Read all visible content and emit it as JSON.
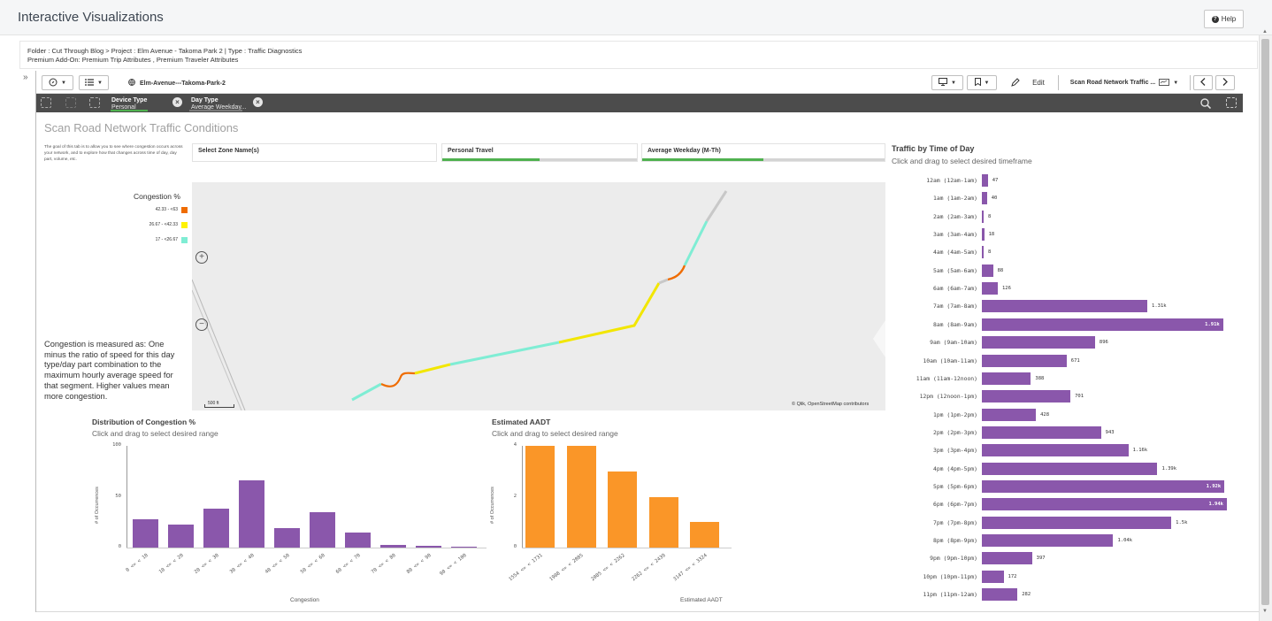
{
  "app": {
    "title": "Interactive Visualizations",
    "help_label": "Help"
  },
  "breadcrumb": {
    "line1": "Folder : Cut Through Blog  >  Project : Elm Avenue - Takoma Park 2  |  Type : Traffic Diagnostics",
    "line2": "Premium Add-On:  Premium Trip Attributes ,  Premium Traveler Attributes"
  },
  "toolbar": {
    "app_name": "Elm-Avenue---Takoma-Park-2",
    "edit_label": "Edit",
    "sheet_name": "Scan Road Network Traffic ...",
    "icons": [
      "compass-icon",
      "list-icon",
      "globe-icon",
      "present-icon",
      "bookmark-icon",
      "pencil-icon",
      "chevron-left-icon",
      "chevron-right-icon"
    ]
  },
  "selections": {
    "chips": [
      {
        "field": "Device Type",
        "value": "Personal"
      },
      {
        "field": "Day Type",
        "value": "Average Weekday..."
      }
    ]
  },
  "sheet": {
    "title": "Scan Road Network Traffic Conditions",
    "intro": "The goal of this tab is to allow you to see where congestion occurs across your network, and to explore how that changes across time of day, day part, volume, etc.",
    "filters": [
      {
        "label": "Select Zone Name(s)",
        "selected_fraction": 0.0
      },
      {
        "label": "Personal Travel",
        "selected_fraction": 0.5
      },
      {
        "label": "Average Weekday (M-Th)",
        "selected_fraction": 0.5
      }
    ],
    "congestion_note": "Congestion is measured as: One minus the ratio of speed for this day type/day part combination to the maximum hourly average speed for that segment. Higher values mean more congestion."
  },
  "legend": {
    "title": "Congestion %",
    "items": [
      {
        "label": "42.33 - <63",
        "color": "#ef6c00"
      },
      {
        "label": "26.67 - <42.33",
        "color": "#fff200"
      },
      {
        "label": "17 - <26.67",
        "color": "#7fedd4"
      }
    ]
  },
  "map": {
    "scale_label": "500 ft",
    "attribution": "© Qlik, OpenStreetMap contributors",
    "colors": {
      "high": "#ef6c00",
      "mid": "#f2e600",
      "low": "#7fedd4",
      "none": "#c8c8c8"
    }
  },
  "colors": {
    "accent": "#8a57ab",
    "orange": "#fa9628",
    "green": "#4fb14f",
    "selbar": "#4c4c4c"
  },
  "charts": {
    "distribution": {
      "title": "Distribution of Congestion %",
      "subtitle": "Click and drag to select desired range"
    },
    "aadt": {
      "title": "Estimated AADT",
      "subtitle": "Click and drag to select desired range"
    },
    "tod": {
      "title": "Traffic by Time of Day",
      "subtitle": "Click and drag to select desired timeframe"
    }
  },
  "chart_data": [
    {
      "type": "bar",
      "title": "Distribution of Congestion %",
      "xlabel": "Congestion",
      "ylabel": "# of Occurrences",
      "categories": [
        "0 <= < 10",
        "10 <= < 20",
        "20 <= < 30",
        "30 <= < 40",
        "40 <= < 50",
        "50 <= < 60",
        "60 <= < 70",
        "70 <= < 80",
        "80 <= < 90",
        "90 <= < 100"
      ],
      "values": [
        28,
        23,
        38,
        66,
        19,
        35,
        15,
        3,
        2,
        1
      ],
      "yticks": [
        "100",
        "50",
        "0"
      ],
      "ylim": [
        0,
        100
      ],
      "color": "#8a57ab"
    },
    {
      "type": "bar",
      "title": "Estimated AADT",
      "xlabel": "Estimated AADT",
      "ylabel": "# of Occurrences",
      "categories": [
        "1554 <= < 1731",
        "1908 <= < 2085",
        "2085 <= < 2262",
        "2262 <= < 2439",
        "3147 <= < 3324"
      ],
      "values": [
        4,
        4,
        3,
        2,
        1
      ],
      "yticks": [
        "4",
        "2",
        "0"
      ],
      "ylim": [
        0,
        4
      ],
      "color": "#fa9628"
    },
    {
      "type": "bar",
      "orientation": "horizontal",
      "title": "Traffic by Time of Day",
      "categories": [
        "12am (12am-1am)",
        "1am (1am-2am)",
        "2am (2am-3am)",
        "3am (3am-4am)",
        "4am (4am-5am)",
        "5am (5am-6am)",
        "6am (6am-7am)",
        "7am (7am-8am)",
        "8am (8am-9am)",
        "9am (9am-10am)",
        "10am (10am-11am)",
        "11am (11am-12noon)",
        "12pm (12noon-1pm)",
        "1pm (1pm-2pm)",
        "2pm (2pm-3pm)",
        "3pm (3pm-4pm)",
        "4pm (4pm-5pm)",
        "5pm (5pm-6pm)",
        "6pm (6pm-7pm)",
        "7pm (7pm-8pm)",
        "8pm (8pm-9pm)",
        "9pm (9pm-10pm)",
        "10pm (10pm-11pm)",
        "11pm (11pm-12am)"
      ],
      "values": [
        47,
        40,
        8,
        18,
        8,
        88,
        126,
        1310,
        1910,
        896,
        671,
        388,
        701,
        428,
        943,
        1160,
        1390,
        1920,
        1940,
        1500,
        1040,
        397,
        172,
        282
      ],
      "labels": [
        "47",
        "40",
        "8",
        "18",
        "8",
        "88",
        "126",
        "1.31k",
        "1.91k",
        "896",
        "671",
        "388",
        "701",
        "428",
        "943",
        "1.16k",
        "1.39k",
        "1.92k",
        "1.94k",
        "1.5k",
        "1.04k",
        "397",
        "172",
        "282"
      ],
      "max": 1940,
      "color": "#8a57ab"
    }
  ]
}
